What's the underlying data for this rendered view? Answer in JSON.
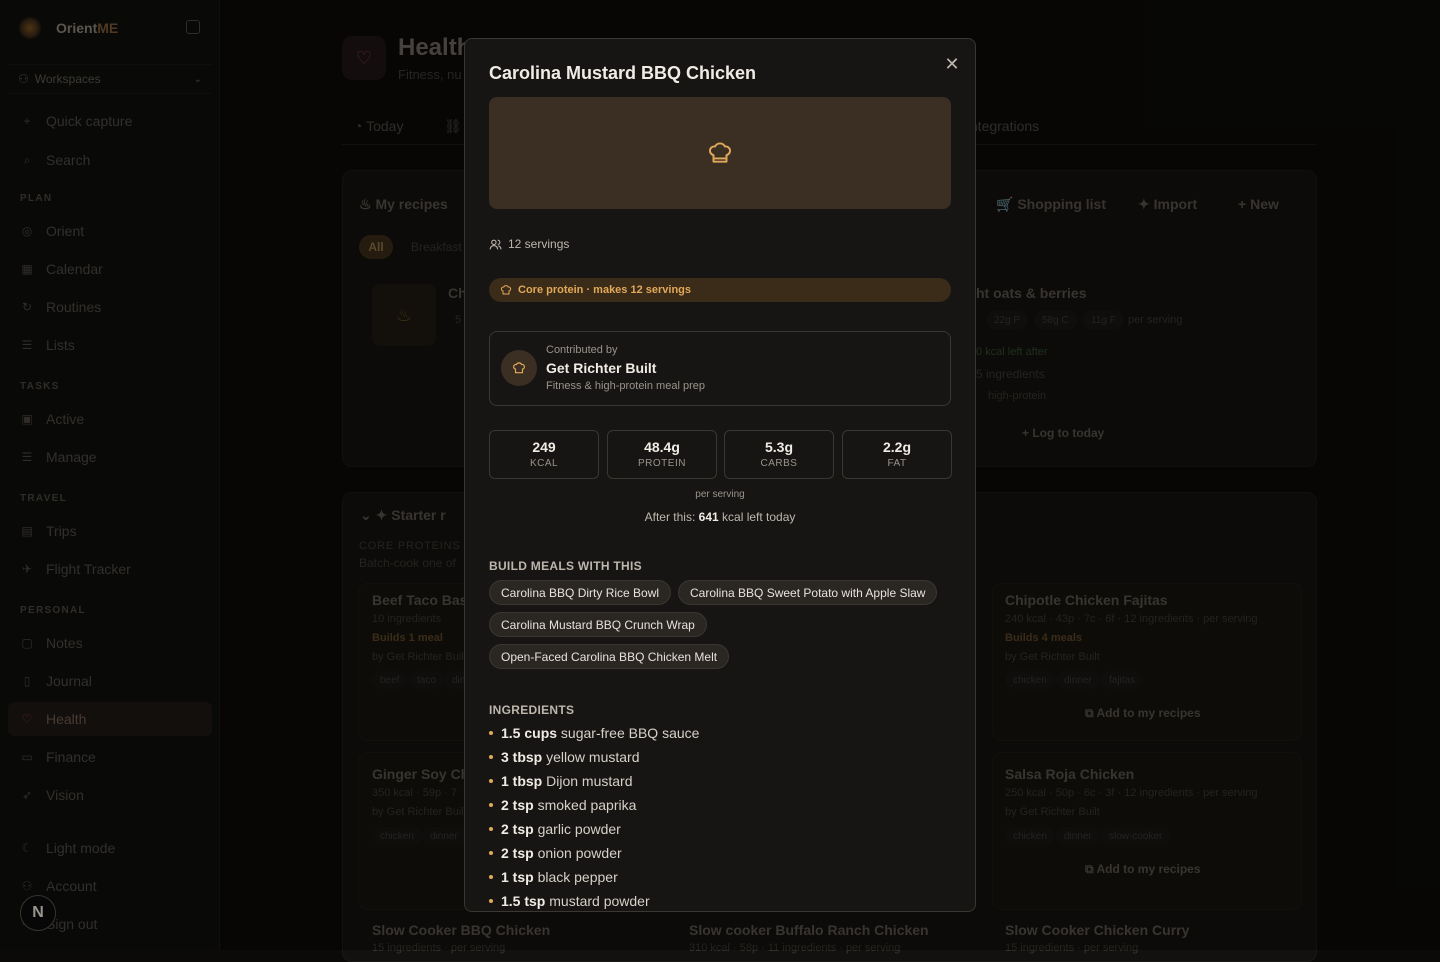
{
  "app": {
    "brand_prefix": "Orient",
    "brand_suffix": "ME",
    "workspaces_label": "Workspaces"
  },
  "sidebar": {
    "quick_capture": "Quick capture",
    "search": "Search",
    "sections": {
      "plan": "PLAN",
      "tasks": "TASKS",
      "travel": "TRAVEL",
      "personal": "PERSONAL"
    },
    "items": {
      "orient": "Orient",
      "calendar": "Calendar",
      "routines": "Routines",
      "lists": "Lists",
      "active": "Active",
      "manage": "Manage",
      "trips": "Trips",
      "flight_tracker": "Flight Tracker",
      "notes": "Notes",
      "journal": "Journal",
      "health": "Health",
      "finance": "Finance",
      "vision": "Vision"
    },
    "light_mode": "Light mode",
    "account": "Account",
    "sign_out": "Sign out",
    "avatar_initial": "N"
  },
  "page": {
    "title": "Health",
    "subtitle": "Fitness, nu"
  },
  "tabs": {
    "today": "Today",
    "integrations": "Integrations"
  },
  "recipes": {
    "heading": "My recipes",
    "shopping_list": "Shopping list",
    "import": "Import",
    "new": "New",
    "filter_all": "All",
    "filter_breakfast": "Breakfast",
    "card_title_partial": "Ch",
    "card_kcal_partial": "5",
    "oats_title": "ht oats & berries",
    "oats_p": "22g P",
    "oats_c": "58g C",
    "oats_f": "11g F",
    "oats_per": "per serving",
    "oats_kcal_left": "0 kcal left after",
    "oats_ingredients": "5 ingredients",
    "oats_tag": "high-protein",
    "log_today": "Log to today"
  },
  "starter": {
    "heading": "Starter r",
    "core_label": "CORE PROTEINS",
    "core_sub": "Batch-cook one of",
    "cards": [
      {
        "title": "Beef Taco Bas",
        "meta": "10 ingredients",
        "builds": "Builds 1 meal",
        "by": "by Get Richter Buil",
        "tags": [
          "beef",
          "taco",
          "din"
        ]
      },
      {
        "title": "Chipotle Chicken Fajitas",
        "meta": "240 kcal · 43p · 7c · 6f · 12 ingredients · per serving",
        "builds": "Builds 4 meals",
        "by": "by Get Richter Built",
        "tags": [
          "chicken",
          "dinner",
          "fajitas"
        ],
        "add": "Add to my recipes"
      },
      {
        "title": "Ginger Soy Ch",
        "meta": "350 kcal · 59p · 7",
        "by": "by Get Richter Buil",
        "tags": [
          "chicken",
          "dinner"
        ]
      },
      {
        "title": "Salsa Roja Chicken",
        "meta": "250 kcal · 50p · 6c · 3f · 12 ingredients · per serving",
        "by": "by Get Richter Built",
        "tags": [
          "chicken",
          "dinner",
          "slow-cooker"
        ],
        "add": "Add to my recipes"
      },
      {
        "title": "Slow Cooker BBQ Chicken",
        "meta": "15 ingredients · per serving"
      },
      {
        "title": "Slow cooker Buffalo Ranch Chicken",
        "meta": "310 kcal · 58p · 11 ingredients · per serving"
      },
      {
        "title": "Slow Cooker Chicken Curry",
        "meta": "15 ingredients · per serving"
      }
    ]
  },
  "modal": {
    "title": "Carolina Mustard BBQ Chicken",
    "servings": "12 servings",
    "tag": "Core protein · makes 12 servings",
    "contributor": {
      "label": "Contributed by",
      "name": "Get Richter Built",
      "desc": "Fitness & high-protein meal prep"
    },
    "macros": [
      {
        "value": "249",
        "label": "KCAL"
      },
      {
        "value": "48.4g",
        "label": "PROTEIN"
      },
      {
        "value": "5.3g",
        "label": "CARBS"
      },
      {
        "value": "2.2g",
        "label": "FAT"
      }
    ],
    "per_serving": "per serving",
    "after_prefix": "After this:",
    "after_value": "641",
    "after_suffix": "kcal left today",
    "build_heading": "BUILD MEALS WITH THIS",
    "meals": [
      "Carolina BBQ Dirty Rice Bowl",
      "Carolina BBQ Sweet Potato with Apple Slaw",
      "Carolina Mustard BBQ Crunch Wrap",
      "Open-Faced Carolina BBQ Chicken Melt"
    ],
    "ingredients_heading": "INGREDIENTS",
    "ingredients": [
      {
        "qty": "1.5 cups",
        "item": "sugar-free BBQ sauce"
      },
      {
        "qty": "3 tbsp",
        "item": "yellow mustard"
      },
      {
        "qty": "1 tbsp",
        "item": "Dijon mustard"
      },
      {
        "qty": "2 tsp",
        "item": "smoked paprika"
      },
      {
        "qty": "2 tsp",
        "item": "garlic powder"
      },
      {
        "qty": "2 tsp",
        "item": "onion powder"
      },
      {
        "qty": "1 tsp",
        "item": "black pepper"
      },
      {
        "qty": "1.5 tsp",
        "item": "mustard powder"
      }
    ]
  }
}
